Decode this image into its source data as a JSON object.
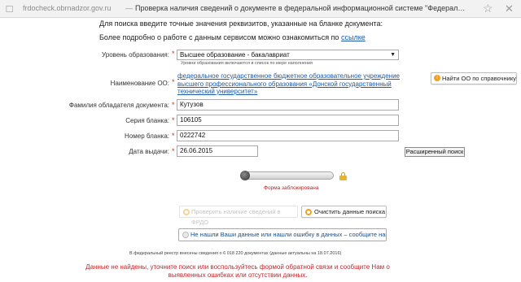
{
  "browser": {
    "domain": "frdocheck.obrnadzor.gov.ru",
    "tab_title": "Проверка наличия сведений о документе в федеральной информационной системе \"Федеральный р...",
    "icons": {
      "page": "document-icon",
      "bookmark": "star-icon",
      "close": "close-icon"
    }
  },
  "intro": {
    "line1": "Для поиска введите точные значения реквизитов, указанные на бланке документа:",
    "line2_prefix": "Более подробно о работе с данным сервисом можно ознакомиться по",
    "line2_link": "ссылке"
  },
  "form": {
    "education_level": {
      "label": "Уровень образования:",
      "required": "*",
      "value": "Высшее образование - бакалавриат",
      "hint": "Уровни образования включаются в список по мере наполнения"
    },
    "organization": {
      "label": "Наименование ОО:",
      "required": "*",
      "value": "федеральное государственное бюджетное образовательное учреждение высшего профессионального образования «Донской государственный технический университет»",
      "find_button": "Найти ОО по справочнику"
    },
    "surname": {
      "label": "Фамилия обладателя документа:",
      "required": "*",
      "value": "Кутузов"
    },
    "series": {
      "label": "Серия бланка:",
      "required": "*",
      "value": "106105"
    },
    "number": {
      "label": "Номер бланка:",
      "required": "*",
      "value": "0222742"
    },
    "issue_date": {
      "label": "Дата выдачи:",
      "required": "*",
      "value": "26.06.2015"
    },
    "advanced_search": "Расширенный поиск"
  },
  "captcha": {
    "status": "Форма заблокирована",
    "icons": {
      "lock": "lock-icon"
    }
  },
  "actions": {
    "check": "Проверить наличие сведений в ФРДО",
    "clear": "Очистить данные поиска",
    "report": "Не нашли Ваши данные или нашли ошибку в данных – сообщите нам"
  },
  "registry_note": "В федеральный реестр внесены сведения о 6 018 220 документах (данные актуальны на 18.07.2016)",
  "error_message": "Данные не найдены, уточните поиск или воспользуйтесь формой обратной связи и сообщите Нам о выявленных ошибках или отсутствии данных.",
  "colors": {
    "required": "#c0392b",
    "link": "#1a5aa8",
    "error": "#c0262b",
    "accent": "#f0a020"
  }
}
